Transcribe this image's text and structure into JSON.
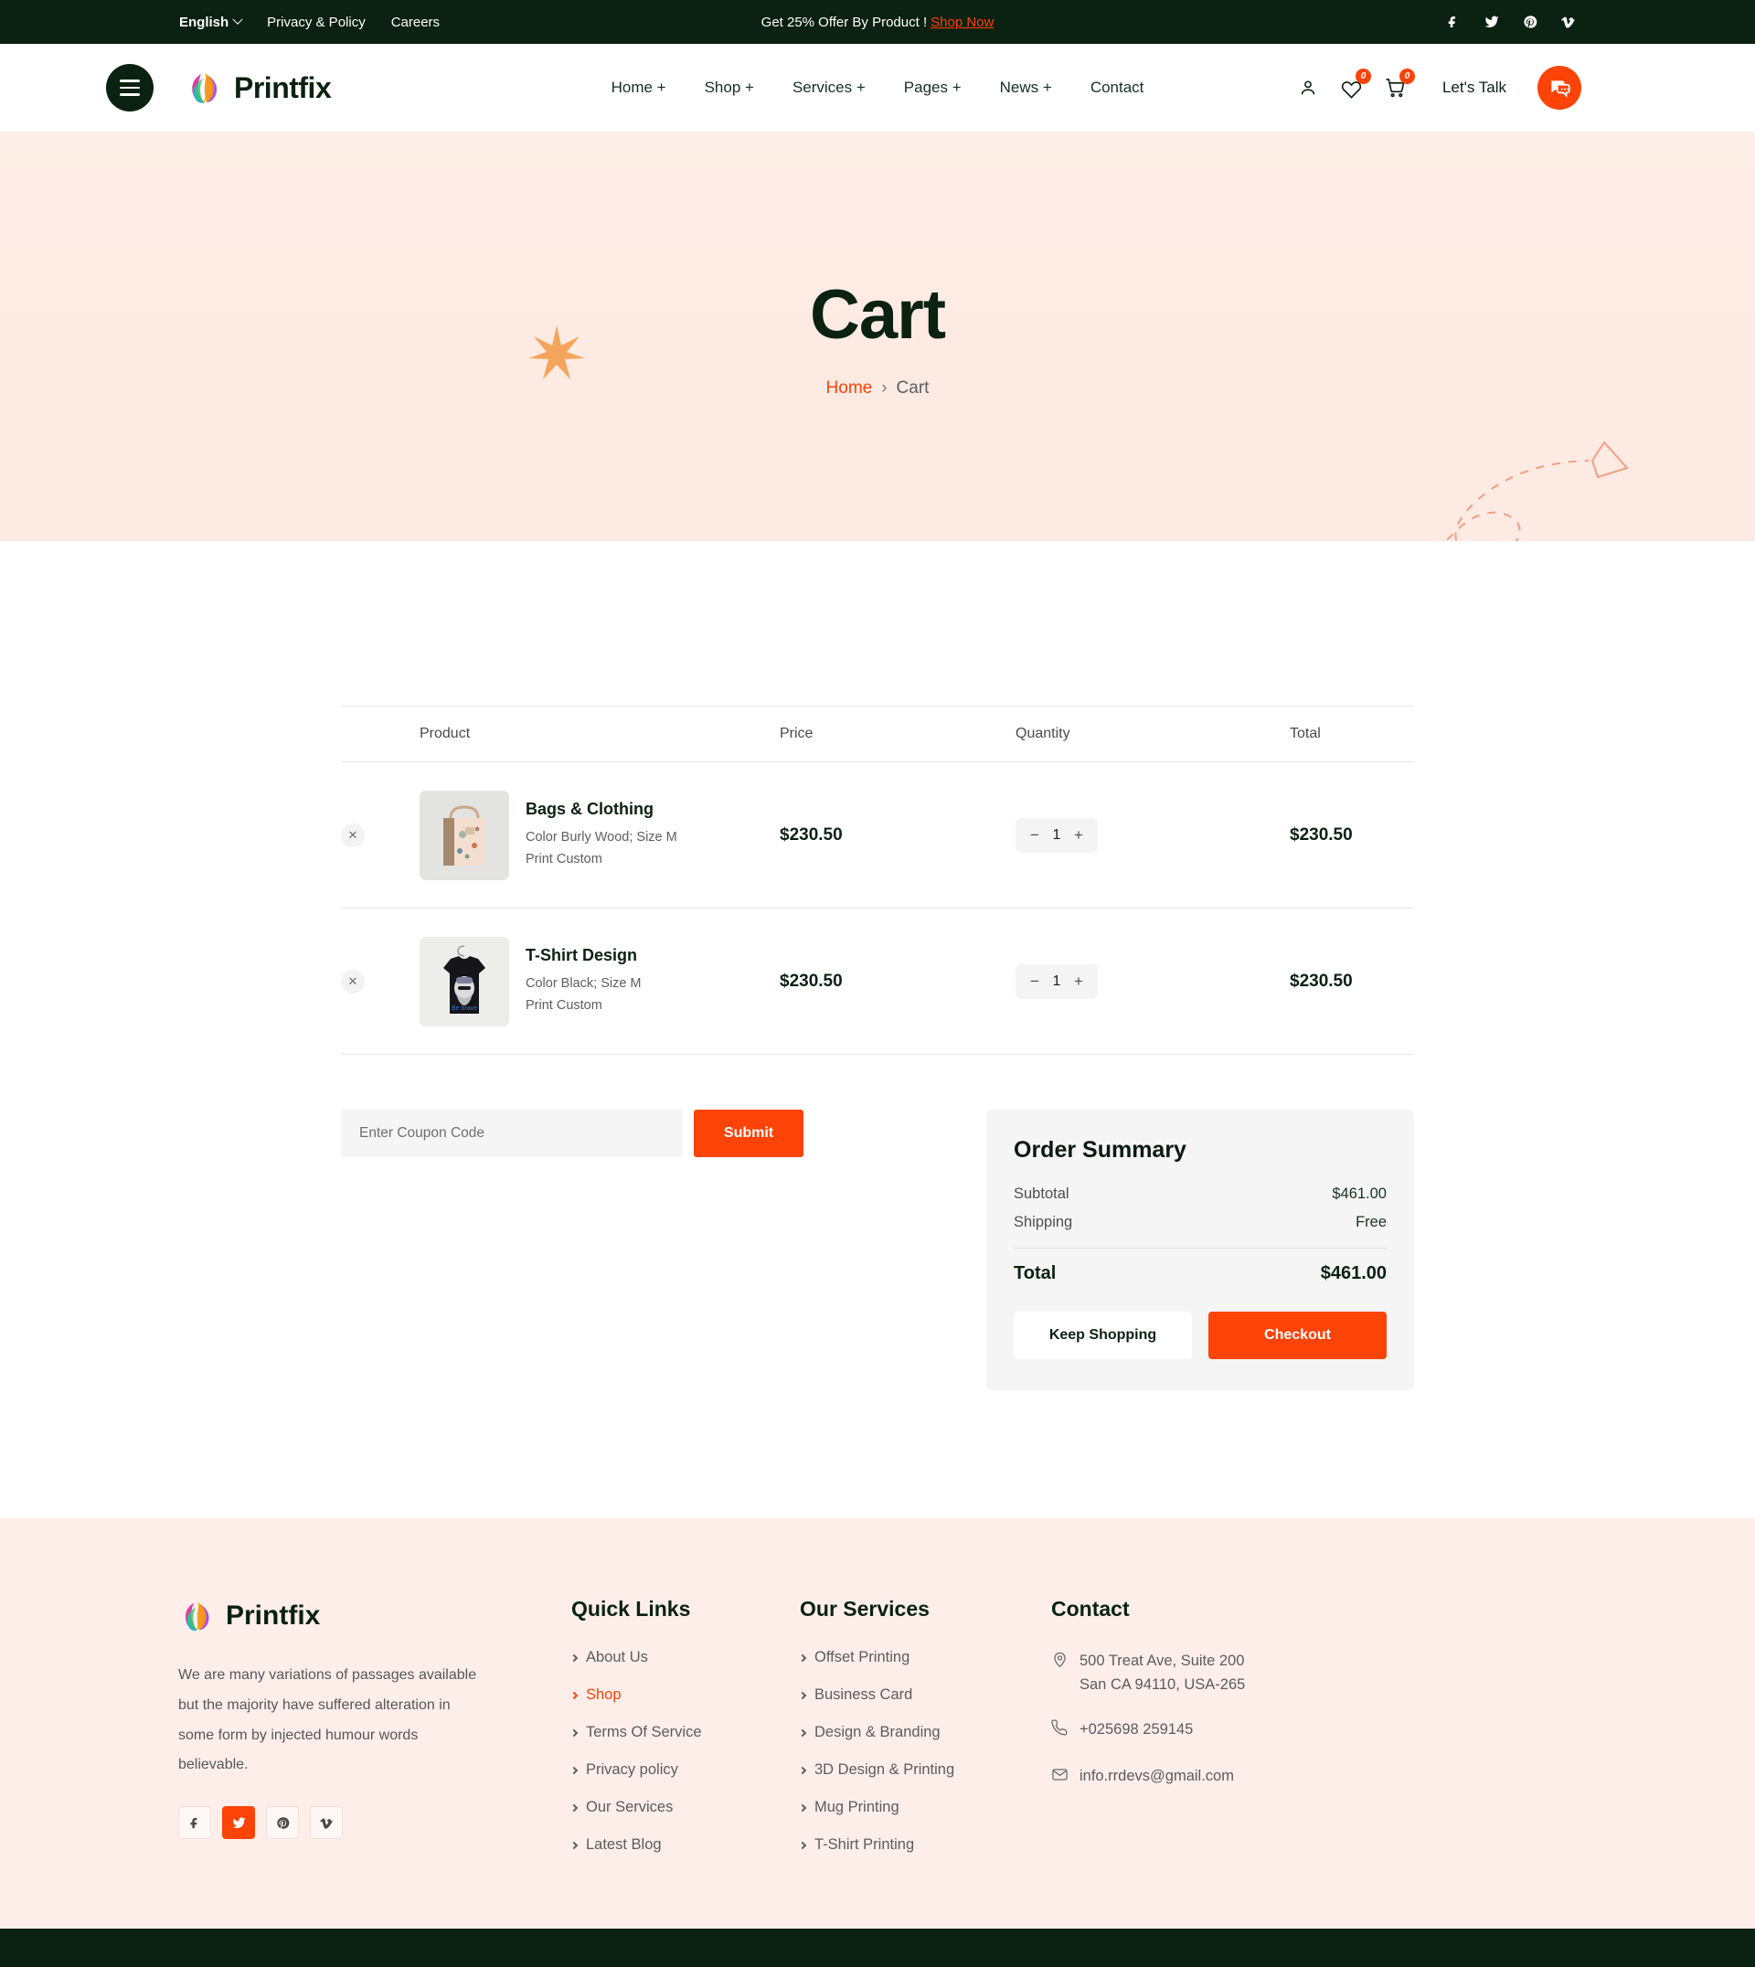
{
  "topbar": {
    "language": "English",
    "links": [
      "Privacy & Policy",
      "Careers"
    ],
    "promo_text": "Get 25% Offer By Product !",
    "promo_cta": "Shop Now",
    "socials": [
      "facebook-icon",
      "twitter-icon",
      "pinterest-icon",
      "vimeo-icon"
    ]
  },
  "header": {
    "brand": "Printfix",
    "nav": [
      "Home +",
      "Shop +",
      "Services +",
      "Pages +",
      "News +",
      "Contact"
    ],
    "wishlist_count": "0",
    "cart_count": "0",
    "lets_talk": "Let's Talk"
  },
  "hero": {
    "title": "Cart",
    "breadcrumb_home": "Home",
    "breadcrumb_sep": "›",
    "breadcrumb_current": "Cart"
  },
  "cart": {
    "columns": [
      "Product",
      "Price",
      "Quantity",
      "Total"
    ],
    "remove_label": "✕",
    "items": [
      {
        "name": "Bags & Clothing",
        "meta1": "Color Burly Wood; Size M",
        "meta2": "Print Custom",
        "price": "$230.50",
        "qty": "1",
        "total": "$230.50",
        "thumb": "tote-bag-image"
      },
      {
        "name": "T-Shirt Design",
        "meta1": "Color Black; Size M",
        "meta2": "Print Custom",
        "price": "$230.50",
        "qty": "1",
        "total": "$230.50",
        "thumb": "black-tshirt-image"
      }
    ],
    "coupon_placeholder": "Enter Coupon Code",
    "coupon_value": "",
    "submit_label": "Submit",
    "minus_label": "−",
    "plus_label": "+"
  },
  "summary": {
    "title": "Order Summary",
    "subtotal_label": "Subtotal",
    "subtotal_value": "$461.00",
    "shipping_label": "Shipping",
    "shipping_value": "Free",
    "total_label": "Total",
    "total_value": "$461.00",
    "keep_shopping": "Keep Shopping",
    "checkout": "Checkout"
  },
  "footer": {
    "brand": "Printfix",
    "description": "We are many variations of passages available but the majority have suffered alteration in some form by injected humour words believable.",
    "socials": [
      "facebook-icon",
      "twitter-icon",
      "pinterest-icon",
      "vimeo-icon"
    ],
    "quick_links_title": "Quick Links",
    "quick_links": [
      "About Us",
      "Shop",
      "Terms Of Service",
      "Privacy policy",
      "Our Services",
      "Latest Blog"
    ],
    "quick_links_active": "Shop",
    "services_title": "Our Services",
    "services": [
      "Offset Printing",
      "Business Card",
      "Design & Branding",
      "3D Design & Printing",
      "Mug Printing",
      "T-Shirt Printing"
    ],
    "contact_title": "Contact",
    "address_line1": "500 Treat Ave, Suite 200",
    "address_line2": "San  CA 94110, USA-265",
    "phone": "+025698 259145",
    "email": "info.rrdevs@gmail.com"
  },
  "colors": {
    "accent": "#fc4308",
    "dark": "#0b2111",
    "hero_bg": "#fdeae2",
    "footer_bg": "#fdeeea"
  }
}
